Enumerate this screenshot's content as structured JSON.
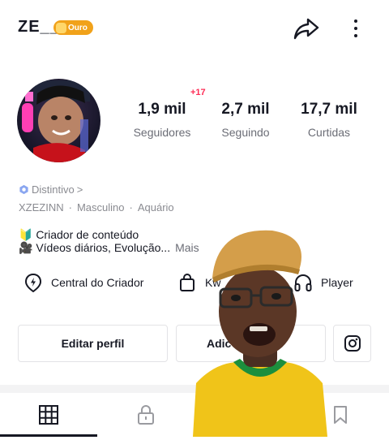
{
  "header": {
    "username": "ZE__",
    "badge_label": "Ouro",
    "share_icon": "share-arrow-icon",
    "more_icon": "more-vertical-icon"
  },
  "profile": {
    "notification_badge": "+17",
    "stats": [
      {
        "value": "1,9 mil",
        "label": "Seguidores"
      },
      {
        "value": "2,7 mil",
        "label": "Seguindo"
      },
      {
        "value": "17,7 mil",
        "label": "Curtidas"
      }
    ],
    "distintivo_label": "Distintivo",
    "distintivo_chevron": ">",
    "nickname": "XZEZINN",
    "gender": "Masculino",
    "sign": "Aquário",
    "separator": "·",
    "bio_line1": "🔰 Criador de conteúdo",
    "bio_line2": "🎥 Vídeos diários, Evolução...",
    "bio_more": "Mais"
  },
  "tools": [
    {
      "label": "Central do Criador",
      "icon": "lightning-pin-icon"
    },
    {
      "label": "Kw",
      "icon": "shopping-bag-icon"
    },
    {
      "label": "Player",
      "icon": "headphones-icon"
    }
  ],
  "actions": {
    "edit_profile": "Editar perfil",
    "add_friends": "Adic          os",
    "instagram_icon": "instagram-icon"
  },
  "tabs": [
    {
      "name": "videos",
      "icon": "grid-icon"
    },
    {
      "name": "private",
      "icon": "lock-icon"
    },
    {
      "name": "saved",
      "icon": "bookmark-icon"
    }
  ],
  "colors": {
    "badge": "#f1a21a",
    "notification": "#fe2c55",
    "text_primary": "#161823",
    "text_secondary": "#8a8b91"
  }
}
